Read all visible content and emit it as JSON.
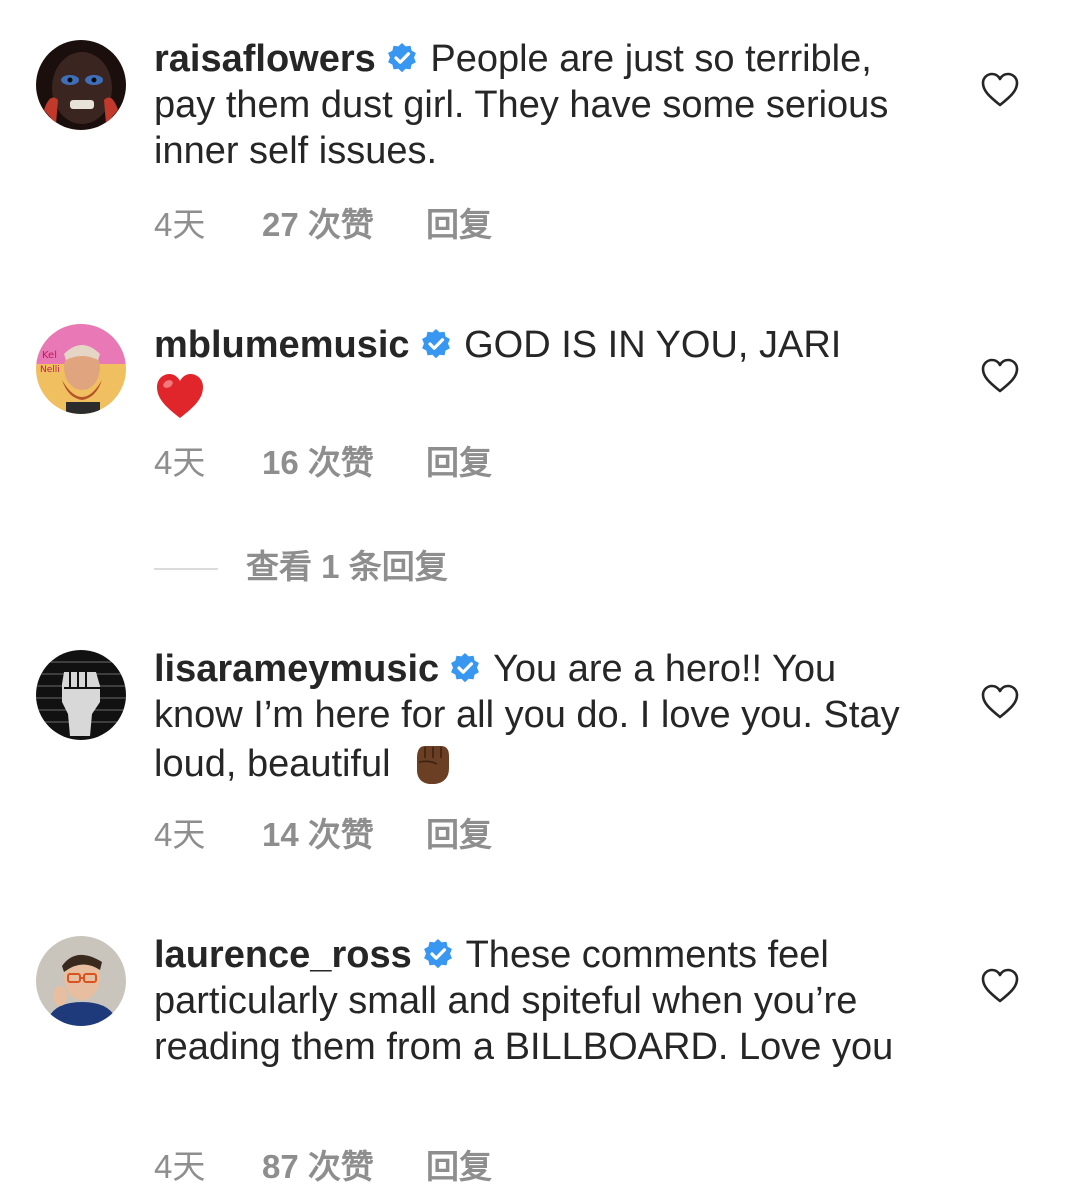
{
  "comments": [
    {
      "username": "raisaflowers",
      "verified": true,
      "text": "People are just so terrible, pay them dust girl. They have some serious inner self issues.",
      "time": "4天",
      "likes": "27 次赞",
      "reply": "回复",
      "avatar_icon": "face-makeup-avatar"
    },
    {
      "username": "mblumemusic",
      "verified": true,
      "text": "GOD IS IN YOU, JARI",
      "emoji": "red-heart",
      "time": "4天",
      "likes": "16 次赞",
      "reply": "回复",
      "avatar_icon": "bearded-man-avatar"
    },
    {
      "username": "lisarameymusic",
      "verified": true,
      "text": "You are a hero!! You know I’m here for all you do. I love you. Stay loud, beautiful",
      "emoji": "raised-fist-dark-skin",
      "time": "4天",
      "likes": "14 次赞",
      "reply": "回复",
      "avatar_icon": "raised-fist-avatar"
    },
    {
      "username": "laurence_ross",
      "verified": true,
      "text": "These comments feel particularly small and spiteful when you’re reading them from a BILLBOARD. Love you",
      "time": "4天",
      "likes": "87 次赞",
      "reply": "回复",
      "avatar_icon": "man-glasses-avatar"
    }
  ],
  "view_replies": "查看 1 条回复",
  "colors": {
    "text": "#262626",
    "meta": "#8e8e8e",
    "verified": "#3897f0",
    "divider": "#dbdbdb"
  }
}
